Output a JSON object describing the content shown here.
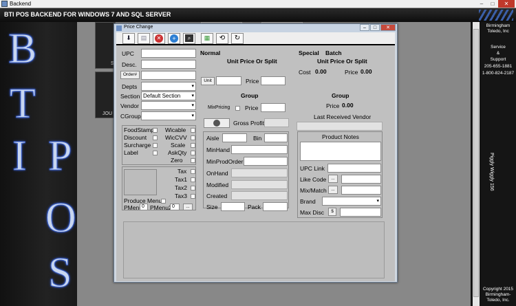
{
  "window": {
    "title": "Backend"
  },
  "app": {
    "header_title": "BTI POS BACKEND FOR WINDOWS 7 AND SQL SERVER"
  },
  "left_letters": [
    "B",
    "T",
    "I",
    "P",
    "O",
    "S"
  ],
  "workspace": {
    "tile_label_1": "S",
    "tile_label_2": "JOU"
  },
  "right_panel": {
    "company": "Birmingham Toledo, Inc",
    "service": "Service",
    "amp": "&",
    "support": "Support",
    "phone1": "205-655-1881",
    "phone2": "1-800-824-2187",
    "vertical": "Piggly Wiggly 156",
    "copyright": "Copyright 2015 Birmingham-Toledo, Inc."
  },
  "dialog": {
    "title": "Price Change",
    "controls": {
      "minimize": "–",
      "maximize": "□",
      "close": "✕"
    }
  },
  "left_form": {
    "upc": "UPC",
    "desc": "Desc.",
    "order_btn": "Order#",
    "depts": "Depts",
    "section": "Section",
    "section_value": "Default Section",
    "vendor": "Vendor",
    "cgroup": "CGroup"
  },
  "flags": {
    "foodstamp": "FoodStamp",
    "wicable": "Wicable",
    "discount": "Discount",
    "wiccvv": "WicCVV",
    "surcharge": "Surcharge",
    "scale": "Scale",
    "label": "Label",
    "askqty": "AskQty",
    "zero": "Zero"
  },
  "tax": {
    "tax": "Tax",
    "tax1": "Tax1",
    "tax2": "Tax2",
    "tax3": "Tax3",
    "produce_menu": "Produce Menu",
    "pmenu": "PMenu",
    "pmenu_value": "0",
    "pmenu2": "PMenu2",
    "pmenu2_value": "0",
    "more_btn": "..."
  },
  "normal": {
    "heading": "Normal",
    "unit_price_heading": "Unit Price Or Split",
    "unit_btn": "Unit",
    "price": "Price",
    "group_heading": "Group",
    "mixpricing": "MixPricing",
    "group_price": "Price",
    "gross_profit": "Gross Profit"
  },
  "special": {
    "heading_special": "Special",
    "heading_batch": "Batch",
    "unit_price_heading": "Unit Price Or Split",
    "cost_label": "Cost",
    "cost_value": "0.00",
    "price_label": "Price",
    "price_value": "0.00",
    "group_heading": "Group",
    "group_price_label": "Price",
    "group_price_value": "0.00",
    "last_vendor": "Last Received Vendor"
  },
  "stock": {
    "aisle": "Aisle",
    "bin": "Bin",
    "minhand": "MinHand",
    "minprodorder": "MinProdOrder",
    "onhand": "OnHand",
    "modified": "Modified",
    "created": "Created",
    "size": "Size",
    "pack": "Pack"
  },
  "product_notes": {
    "heading": "Product Notes",
    "upc_link": "UPC Link",
    "like_code": "Like Code",
    "mix_match": "Mix/Match",
    "brand": "Brand",
    "max_disc": "Max Disc",
    "dollar_btn": "$",
    "more_btn": "..."
  }
}
